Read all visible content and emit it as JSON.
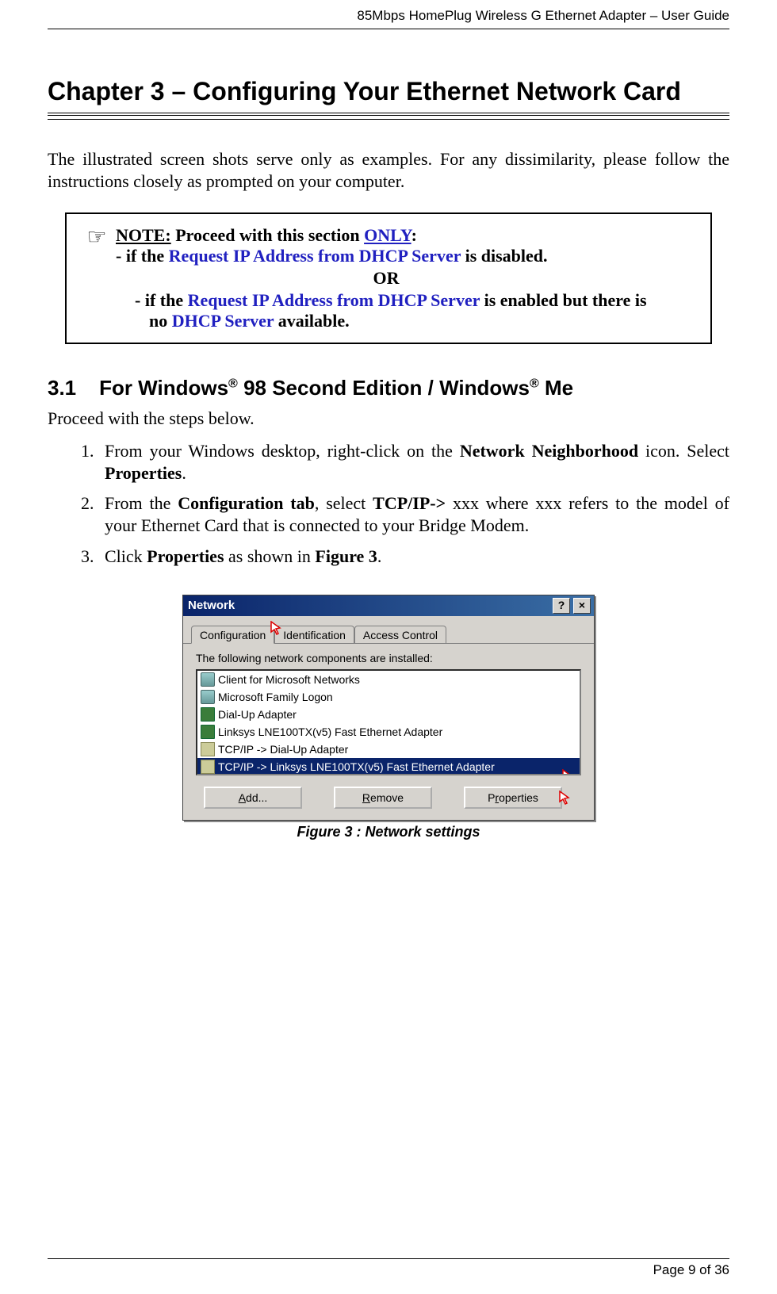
{
  "header": {
    "doc_title": "85Mbps HomePlug Wireless G Ethernet Adapter – User Guide"
  },
  "chapter": {
    "title": "Chapter 3  – Configuring Your Ethernet Network Card"
  },
  "intro": "The illustrated screen shots serve only as examples. For any dissimilarity, please follow the instructions closely as prompted on your computer.",
  "note": {
    "label": "NOTE:",
    "lead": " Proceed with this section ",
    "only": "ONLY",
    "colon": ":",
    "line1_pre": "- if the ",
    "line1_emph": "Request IP Address from DHCP Server",
    "line1_post": " is disabled.",
    "or": "OR",
    "line2_pre": "- if the ",
    "line2_emph": "Request IP Address from DHCP Server",
    "line2_mid": " is enabled but there is",
    "line3_pre": "no ",
    "line3_emph": "DHCP Server",
    "line3_post": " available."
  },
  "section": {
    "num": "3.1",
    "title_a": "For Windows",
    "reg": "®",
    "title_b": " 98 Second Edition / Windows",
    "title_c": " Me"
  },
  "proceed": "Proceed with the steps below.",
  "steps": {
    "s1a": "From your Windows desktop, right-click on the ",
    "s1b": "Network Neighborhood",
    "s1c": " icon. Select ",
    "s1d": "Properties",
    "s1e": ".",
    "s2a": "From the ",
    "s2b": "Configuration tab",
    "s2c": ", select ",
    "s2d": "TCP/IP->",
    "s2e": " xxx where xxx refers to the model of your Ethernet Card that is connected to your Bridge Modem.",
    "s3a": "Click ",
    "s3b": "Properties",
    "s3c": " as shown in ",
    "s3d": "Figure 3",
    "s3e": "."
  },
  "figure": {
    "window_title": "Network",
    "tabs": {
      "t1": "Configuration",
      "t2": "Identification",
      "t3": "Access Control"
    },
    "body_text": "The following network components are installed:",
    "items": {
      "i1": "Client for Microsoft Networks",
      "i2": "Microsoft Family Logon",
      "i3": "Dial-Up Adapter",
      "i4": "Linksys LNE100TX(v5) Fast Ethernet Adapter",
      "i5": "TCP/IP -> Dial-Up Adapter",
      "i6": "TCP/IP -> Linksys LNE100TX(v5) Fast Ethernet Adapter"
    },
    "buttons": {
      "add_u": "A",
      "add": "dd...",
      "remove_u": "R",
      "remove": "emove",
      "prop_label": "P",
      "prop_rest": "roperties"
    },
    "caption": "Figure 3 : Network settings"
  },
  "footer": {
    "page": "Page 9 of 36"
  }
}
